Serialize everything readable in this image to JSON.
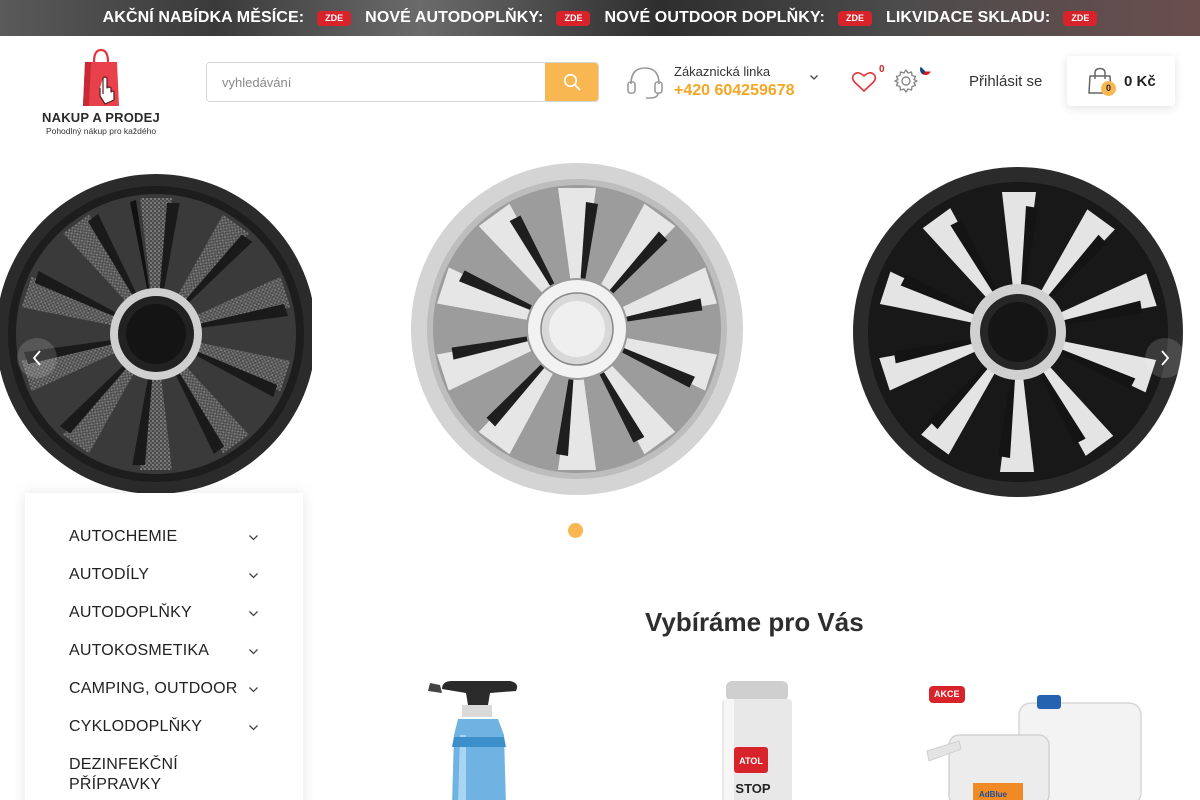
{
  "promo_bar": {
    "items": [
      {
        "text": "AKČNÍ NABÍDKA MĚSÍCE:",
        "badge": "ZDE"
      },
      {
        "text": "NOVÉ AUTODOPLŇKY:",
        "badge": "ZDE"
      },
      {
        "text": "NOVÉ OUTDOOR DOPLŇKY:",
        "badge": "ZDE"
      },
      {
        "text": "LIKVIDACE SKLADU:",
        "badge": "ZDE"
      }
    ]
  },
  "logo": {
    "title": "NAKUP A PRODEJ",
    "subtitle": "Pohodlný nákup pro každého"
  },
  "search": {
    "placeholder": "vyhledávání",
    "icon": "search-icon"
  },
  "support": {
    "label": "Zákaznická linka",
    "phone": "+420 604259678"
  },
  "wishlist": {
    "count": "0"
  },
  "header": {
    "login_label": "Přihlásit se"
  },
  "cart": {
    "count": "0",
    "total": "0 Kč"
  },
  "slider": {
    "slides": [
      "black-carbon-wheel-cover",
      "silver-black-wheel-cover",
      "black-silver-wheel-cover"
    ],
    "active_dot": 1,
    "dot_count": 1
  },
  "categories": [
    {
      "label": "AUTOCHEMIE"
    },
    {
      "label": "AUTODÍLY"
    },
    {
      "label": "AUTODOPLŇKY"
    },
    {
      "label": "AUTOKOSMETIKA"
    },
    {
      "label": "CAMPING, OUTDOOR"
    },
    {
      "label": "CYKLODOPLŇKY"
    },
    {
      "label": "DEZINFEKČNÍ PŘÍPRAVKY"
    }
  ],
  "recommended": {
    "title": "Vybíráme pro Vás",
    "products": [
      {
        "name": "spray-bottle-product",
        "badge": ""
      },
      {
        "name": "atol-stop-spray-product",
        "badge": ""
      },
      {
        "name": "adblue-canister-product",
        "badge": "AKCE"
      }
    ]
  },
  "colors": {
    "accent": "#f8b750",
    "phone": "#f5a623",
    "badge_red": "#d8232a"
  }
}
